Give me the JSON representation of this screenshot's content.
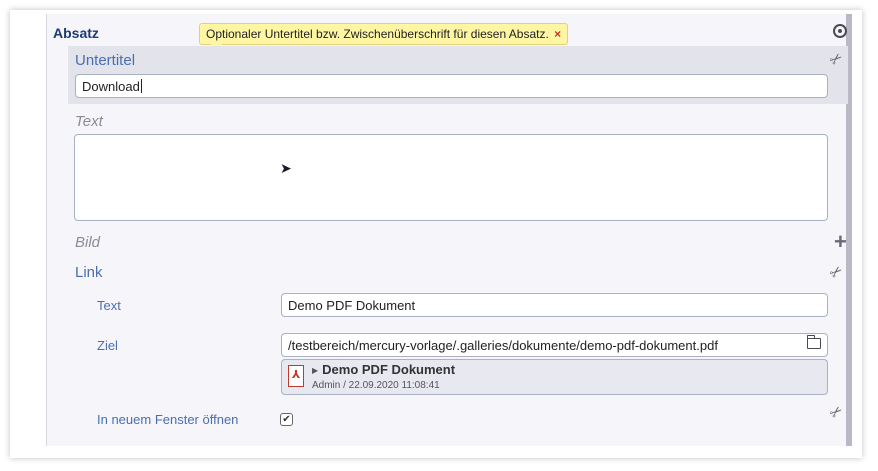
{
  "section": {
    "title": "Absatz",
    "tooltip": "Optionaler Untertitel bzw. Zwischenüberschrift für diesen Absatz.",
    "tooltip_close": "×"
  },
  "untertitel": {
    "label": "Untertitel",
    "value": "Download"
  },
  "text": {
    "label": "Text",
    "value": ""
  },
  "bild": {
    "label": "Bild"
  },
  "link": {
    "label": "Link",
    "text_label": "Text",
    "text_value": "Demo PDF Dokument",
    "ziel_label": "Ziel",
    "ziel_value": "/testbereich/mercury-vorlage/.galleries/dokumente/demo-pdf-dokument.pdf",
    "file": {
      "name": "Demo PDF Dokument",
      "meta": "Admin / 22.09.2020 11:08:41"
    },
    "new_window_label": "In neuem Fenster öffnen",
    "new_window_checked": true
  },
  "icons": [
    "target-icon",
    "scissors-icon",
    "plus-icon",
    "folder-icon",
    "pdf-icon",
    "mouse-cursor-icon",
    "triangle-right-icon"
  ]
}
